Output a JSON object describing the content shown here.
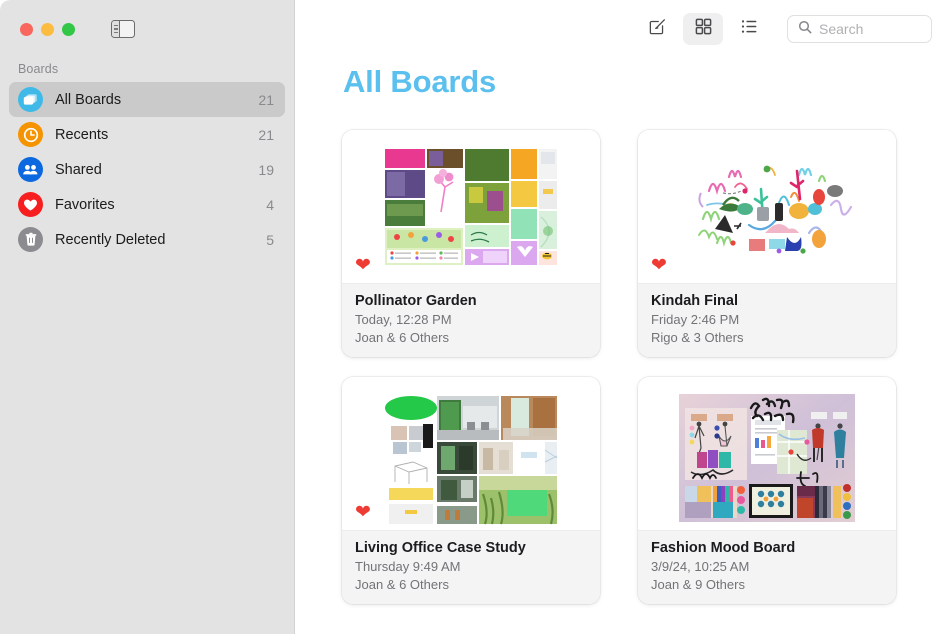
{
  "window": {
    "traffic_lights": [
      "close",
      "minimize",
      "zoom"
    ],
    "sidebar_toggle_icon": "sidebar-toggle-icon"
  },
  "sidebar": {
    "section_label": "Boards",
    "items": [
      {
        "label": "All Boards",
        "count": "21",
        "icon": "boards-icon",
        "color": "#3fb9e8",
        "selected": true
      },
      {
        "label": "Recents",
        "count": "21",
        "icon": "clock-icon",
        "color": "#f59300",
        "selected": false
      },
      {
        "label": "Shared",
        "count": "19",
        "icon": "people-icon",
        "color": "#0b68de",
        "selected": false
      },
      {
        "label": "Favorites",
        "count": "4",
        "icon": "heart-icon",
        "color": "#f71e20",
        "selected": false
      },
      {
        "label": "Recently Deleted",
        "count": "5",
        "icon": "trash-icon",
        "color": "#8b8b90",
        "selected": false
      }
    ]
  },
  "toolbar": {
    "new_board_label": "compose-icon",
    "grid_view_label": "grid-view-icon",
    "list_view_label": "list-view-icon",
    "grid_view_active": true,
    "search_placeholder": "Search",
    "search_value": ""
  },
  "main": {
    "title": "All Boards",
    "title_color": "#5bc0ee"
  },
  "boards": [
    {
      "title": "Pollinator Garden",
      "date": "Today, 12:28 PM",
      "participants": "Joan & 6 Others",
      "favorite": true,
      "thumb": "pollinator-garden-thumbnail"
    },
    {
      "title": "Kindah Final",
      "date": "Friday 2:46 PM",
      "participants": "Rigo & 3 Others",
      "favorite": true,
      "thumb": "kindah-final-thumbnail"
    },
    {
      "title": "Living Office Case Study",
      "date": "Thursday 9:49 AM",
      "participants": "Joan & 6 Others",
      "favorite": true,
      "thumb": "living-office-thumbnail"
    },
    {
      "title": "Fashion Mood Board",
      "date": "3/9/24, 10:25 AM",
      "participants": "Joan & 9 Others",
      "favorite": true,
      "thumb": "fashion-mood-board-thumbnail"
    }
  ]
}
